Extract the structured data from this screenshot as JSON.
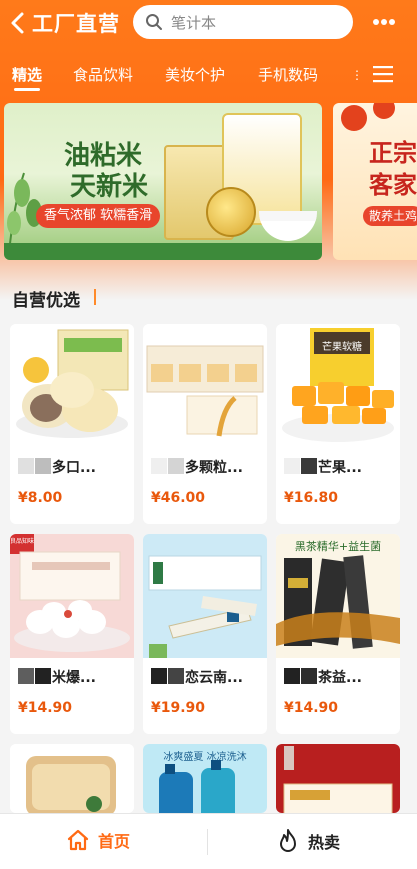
{
  "header": {
    "title": "工厂直营",
    "search_placeholder": "笔计本"
  },
  "tabs": [
    {
      "label": "精选"
    },
    {
      "label": "食品饮料"
    },
    {
      "label": "美妆个护"
    },
    {
      "label": "手机数码"
    }
  ],
  "banner": {
    "headline_line1": "油粘米",
    "headline_line2": "天新米",
    "tagline": "香气浓郁 软糯香滑",
    "side_headline": "正宗客家",
    "side_tagline": "散养土鸡"
  },
  "section": {
    "title": "自营优选"
  },
  "products": [
    {
      "name": "多口...",
      "price": "¥8.00"
    },
    {
      "name": "多颗粒...",
      "price": "¥46.00"
    },
    {
      "name": "芒果...",
      "price": "¥16.80"
    },
    {
      "name": "米爆...",
      "price": "¥14.90"
    },
    {
      "name": "恋云南...",
      "price": "¥19.90"
    },
    {
      "name": "茶益...",
      "price": "¥14.90"
    }
  ],
  "product_images": {
    "p3_label": "芒果软糖",
    "p4_label": "良品知味",
    "p6_label": "黑茶精华+益生菌",
    "p8_label": "冰爽盛夏 冰凉洗沐"
  },
  "bottom_nav": {
    "home_label": "首页",
    "hot_label": "热卖"
  },
  "colors": {
    "brand_orange": "#ff6a14",
    "price_orange": "#e9580c"
  }
}
